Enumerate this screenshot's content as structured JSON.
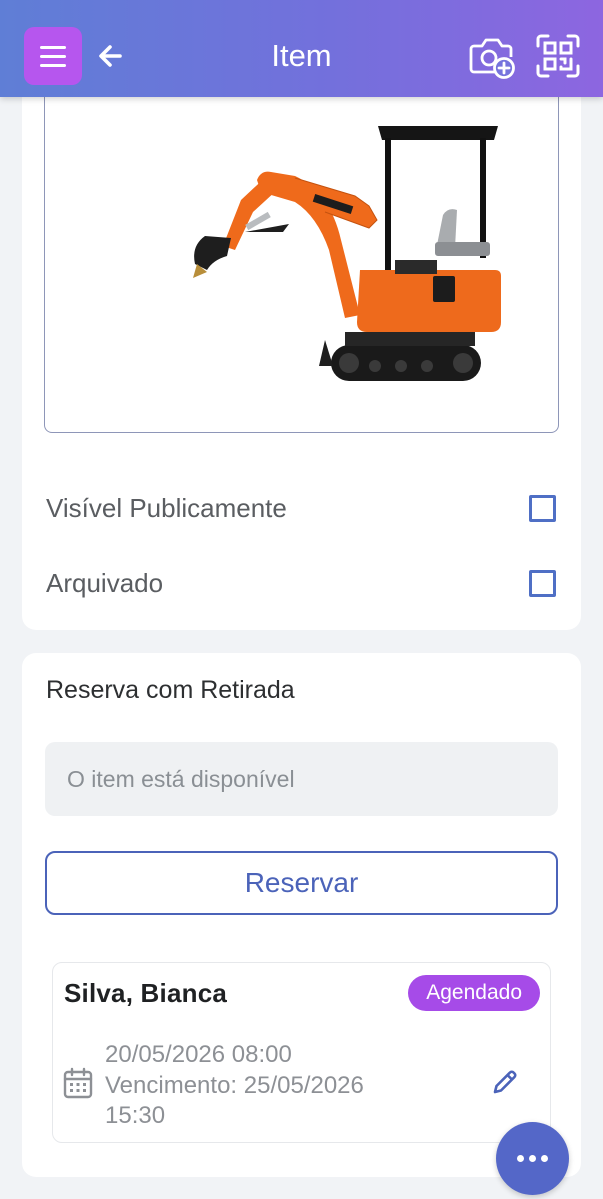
{
  "header": {
    "title": "Item",
    "menu_icon": "hamburger-icon",
    "back_icon": "arrow-left-icon",
    "camera_icon": "camera-add-icon",
    "scan_icon": "qr-scan-icon",
    "gradient_start": "#5f7ed6",
    "gradient_end": "#8d66e0",
    "menu_color": "#b656ee"
  },
  "item": {
    "image_icon": "mini-excavator-photo",
    "public_label": "Visível Publicamente",
    "public_checked": false,
    "archived_label": "Arquivado",
    "archived_checked": false
  },
  "reservation": {
    "section_title": "Reserva com Retirada",
    "availability_text": "O item está disponível",
    "reserve_button": "Reservar",
    "booking": {
      "name": "Silva, Bianca",
      "status": "Agendado",
      "status_color": "#a64be8",
      "start": "20/05/2026 08:00",
      "due_line1": "Vencimento: 25/05/2026",
      "due_line2": "15:30",
      "calendar_icon": "calendar-icon",
      "edit_icon": "pencil-icon"
    }
  },
  "fab": {
    "icon": "more-dots-icon"
  },
  "colors": {
    "accent": "#4b63b9",
    "background": "#f1f3f6"
  }
}
